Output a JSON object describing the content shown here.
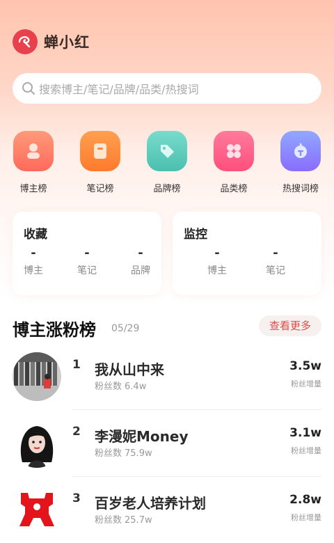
{
  "app": {
    "title": "蝉小红"
  },
  "search": {
    "placeholder": "搜索博主/笔记/品牌/品类/热搜词"
  },
  "categories": [
    {
      "label": "博主榜",
      "icon": "blogger-icon",
      "color": "#ff7a5c"
    },
    {
      "label": "笔记榜",
      "icon": "note-icon",
      "color": "#ff8a3d"
    },
    {
      "label": "品牌榜",
      "icon": "tag-icon",
      "color": "#5ccfc0"
    },
    {
      "label": "品类榜",
      "icon": "category-grid-icon",
      "color": "#ff5f8c"
    },
    {
      "label": "热搜词榜",
      "icon": "hot-search-icon",
      "color": "#7f8dff"
    }
  ],
  "favorites": {
    "title": "收藏",
    "stats": [
      {
        "value": "-",
        "label": "博主"
      },
      {
        "value": "-",
        "label": "笔记"
      },
      {
        "value": "-",
        "label": "品牌"
      }
    ]
  },
  "monitor": {
    "title": "监控",
    "stats": [
      {
        "value": "-",
        "label": "博主"
      },
      {
        "value": "-",
        "label": "笔记"
      }
    ]
  },
  "ranking": {
    "title": "博主涨粉榜",
    "date": "05/29",
    "more_label": "查看更多",
    "fans_label": "粉丝数",
    "increase_label": "粉丝增量",
    "items": [
      {
        "rank": "1",
        "name": "我从山中来",
        "fans": "6.4w",
        "increase": "3.5w"
      },
      {
        "rank": "2",
        "name": "李漫妮Money",
        "fans": "75.9w",
        "increase": "3.1w"
      },
      {
        "rank": "3",
        "name": "百岁老人培养计划",
        "fans": "25.7w",
        "increase": "2.8w"
      }
    ]
  }
}
